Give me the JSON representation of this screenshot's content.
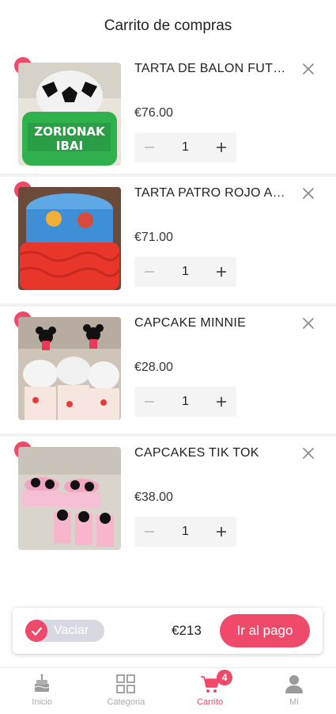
{
  "header": {
    "title": "Carrito de compras"
  },
  "items": [
    {
      "title": "TARTA DE BALON FUTBOL IBAI",
      "price": "€76.00",
      "qty": "1"
    },
    {
      "title": "TARTA PATRO ROJO AZUL",
      "price": "€71.00",
      "qty": "1"
    },
    {
      "title": "CAPCAKE MINNIE",
      "price": "€28.00",
      "qty": "1"
    },
    {
      "title": "CAPCAKES TIK TOK",
      "price": "€38.00",
      "qty": "1"
    }
  ],
  "checkout": {
    "clear_label": "Vaciar",
    "total": "€213",
    "pay_label": "Ir al pago"
  },
  "tabs": [
    {
      "label": "Inicio",
      "icon": "cake-icon"
    },
    {
      "label": "Categoria",
      "icon": "grid-icon"
    },
    {
      "label": "Carrito",
      "icon": "cart-icon",
      "badge": "4"
    },
    {
      "label": "Mi",
      "icon": "user-icon"
    }
  ],
  "colors": {
    "accent": "#f04a6a",
    "muted": "#aaaaaa"
  }
}
